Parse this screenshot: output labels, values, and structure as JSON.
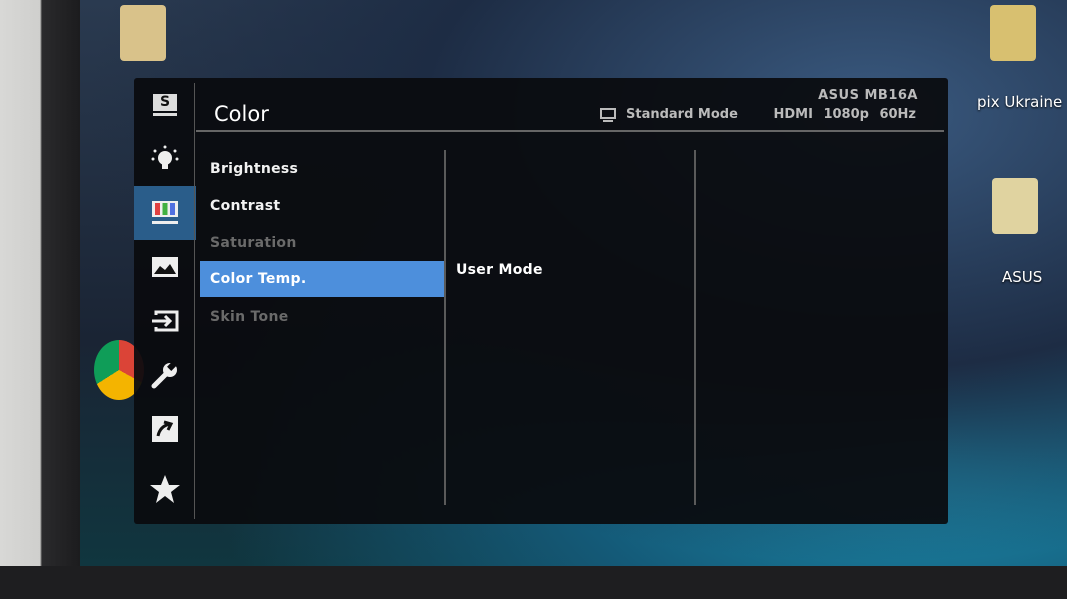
{
  "desktop": {
    "labels": [
      "pix Ukraine",
      "ASUS"
    ]
  },
  "osd": {
    "title": "Color",
    "model": "ASUS MB16A",
    "mode": {
      "icon": "monitor-icon",
      "label": "Standard Mode"
    },
    "signal": "HDMI 1080p 60Hz",
    "sidebar": [
      {
        "icon": "splendid-icon",
        "glyph": "S"
      },
      {
        "icon": "blue-light-filter-icon"
      },
      {
        "icon": "color-icon",
        "active": true
      },
      {
        "icon": "image-icon"
      },
      {
        "icon": "input-select-icon"
      },
      {
        "icon": "system-setup-icon"
      },
      {
        "icon": "shortcut-icon"
      },
      {
        "icon": "my-favorite-icon"
      }
    ],
    "menu": [
      {
        "label": "Brightness",
        "state": "enabled"
      },
      {
        "label": "Contrast",
        "state": "enabled"
      },
      {
        "label": "Saturation",
        "state": "disabled"
      },
      {
        "label": "Color Temp.",
        "state": "selected"
      },
      {
        "label": "Skin Tone",
        "state": "disabled"
      }
    ],
    "submenu": {
      "value": "User Mode"
    },
    "colors": {
      "accent": "#4d8fdc",
      "active_sidebar": "#2a5d8a",
      "background": "#0a0b0e"
    }
  }
}
